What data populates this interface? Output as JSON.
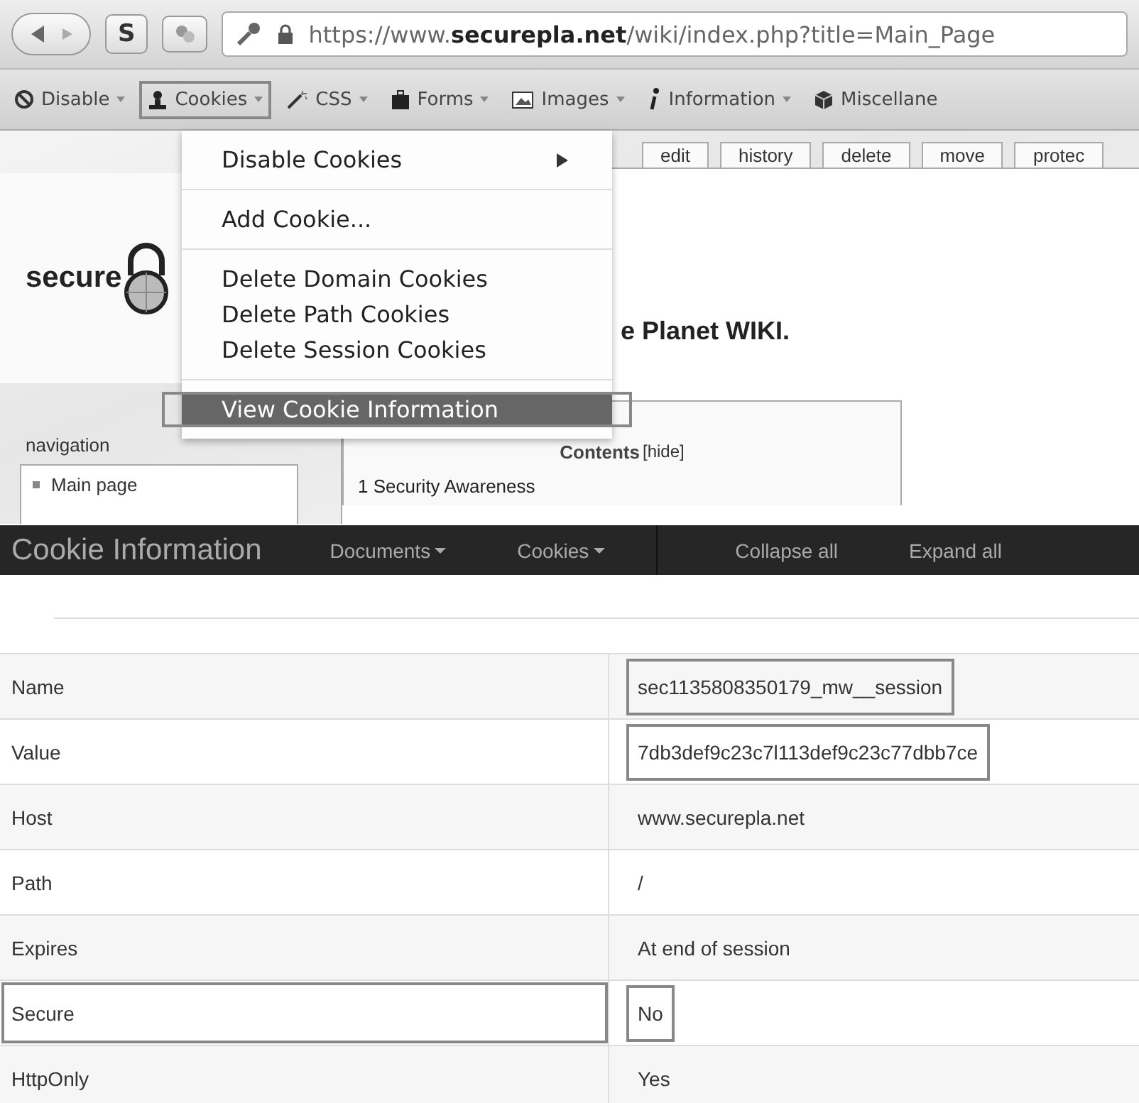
{
  "browser": {
    "s_button": "S",
    "url": "https://www.**securepla.net**/wiki/index.php?title=Main_Page"
  },
  "toolbar": [
    {
      "label": "Disable",
      "dropdown": true,
      "framed": false
    },
    {
      "label": "Cookies",
      "dropdown": true,
      "framed": true
    },
    {
      "label": "CSS",
      "dropdown": true,
      "framed": false
    },
    {
      "label": "Forms",
      "dropdown": true,
      "framed": false
    },
    {
      "label": "Images",
      "dropdown": true,
      "framed": false
    },
    {
      "label": "Information",
      "dropdown": true,
      "framed": false
    },
    {
      "label": "Miscellane",
      "dropdown": false,
      "framed": false
    }
  ],
  "menu": {
    "groups": [
      [
        {
          "label": "Disable Cookies",
          "submenu": true,
          "selected": false,
          "framed": false
        }
      ],
      [
        {
          "label": "Add Cookie...",
          "submenu": false,
          "selected": false,
          "framed": false
        }
      ],
      [
        {
          "label": "Delete Domain Cookies",
          "submenu": false,
          "selected": false,
          "framed": false
        },
        {
          "label": "Delete Path Cookies",
          "submenu": false,
          "selected": false,
          "framed": false
        },
        {
          "label": "Delete Session Cookies",
          "submenu": false,
          "selected": false,
          "framed": false
        }
      ],
      [
        {
          "label": "View Cookie Information",
          "submenu": false,
          "selected": true,
          "framed": true
        }
      ]
    ]
  },
  "page": {
    "logo_text": "secure",
    "nav_heading": "navigation",
    "nav_items": [
      "Main page"
    ],
    "tabs": [
      "edit",
      "history",
      "delete",
      "move",
      "protec"
    ],
    "heading": "e Planet WIKI.",
    "contents_title": "Contents",
    "contents_toggle": "[hide]",
    "contents_items": [
      "1 Security Awareness"
    ]
  },
  "cookie_panel": {
    "title": "Cookie Information",
    "menus": [
      {
        "label": "Documents",
        "dropdown": true,
        "divider_before": false
      },
      {
        "label": "Cookies",
        "dropdown": true,
        "divider_before": false
      },
      {
        "label": "Collapse all",
        "dropdown": false,
        "divider_before": true
      },
      {
        "label": "Expand all",
        "dropdown": false,
        "divider_before": false
      }
    ],
    "rows": [
      {
        "name": "Name",
        "value": "sec1135808350179_mw__session",
        "framed_name": false,
        "framed_value": true
      },
      {
        "name": "Value",
        "value": "7db3def9c23c7l113def9c23c77dbb7ce",
        "framed_name": false,
        "framed_value": true
      },
      {
        "name": "Host",
        "value": "www.securepla.net",
        "framed_name": false,
        "framed_value": false
      },
      {
        "name": "Path",
        "value": "/",
        "framed_name": false,
        "framed_value": false
      },
      {
        "name": "Expires",
        "value": "At end of session",
        "framed_name": false,
        "framed_value": false
      },
      {
        "name": "Secure",
        "value": "No",
        "framed_name": true,
        "framed_value": true
      },
      {
        "name": "HttpOnly",
        "value": "Yes",
        "framed_name": false,
        "framed_value": false
      }
    ]
  }
}
